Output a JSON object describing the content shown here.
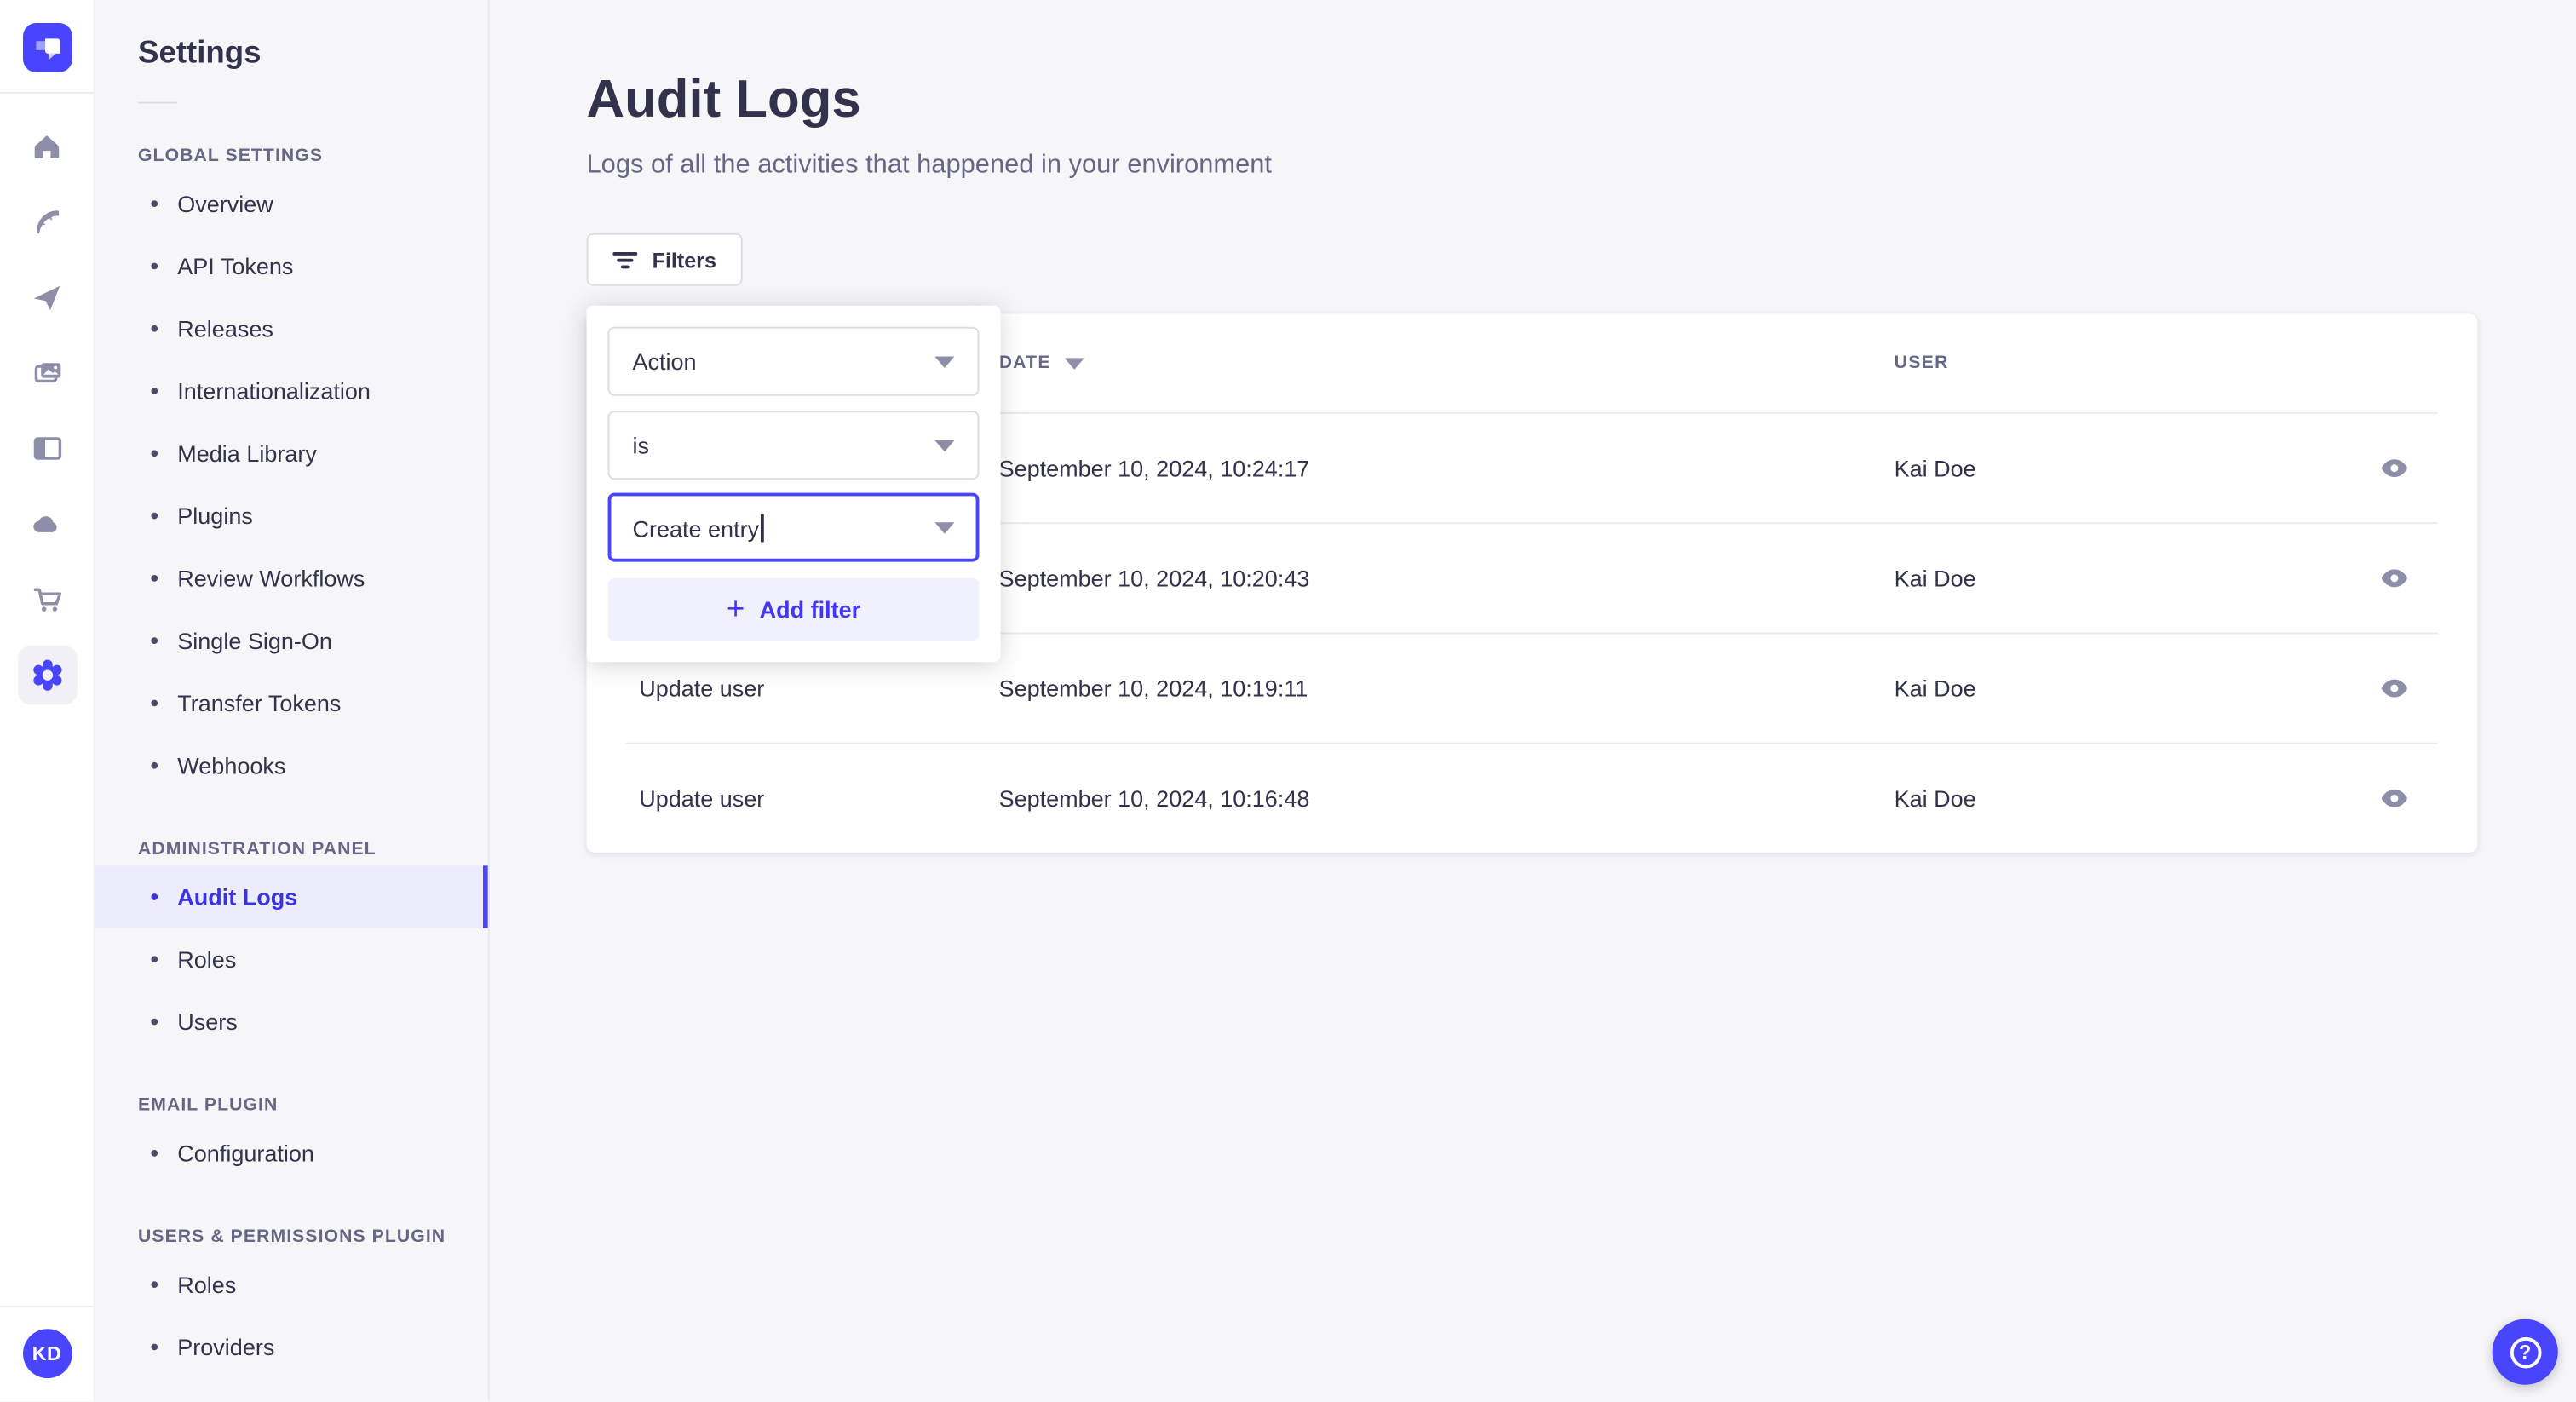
{
  "colors": {
    "accent": "#4945ff",
    "accent_light_bg": "#f0f0ff",
    "active_nav_text": "#3a33e0",
    "text": "#32324d",
    "muted_text": "#666687",
    "icon_gray": "#8e8ea9",
    "border": "#dcdce4",
    "divider": "#eaeaef",
    "page_bg": "#f6f6f9"
  },
  "icon_rail": {
    "logo_icon": "strapi-logo",
    "items": [
      {
        "icon": "home-icon"
      },
      {
        "icon": "feather-icon"
      },
      {
        "icon": "paper-plane-icon"
      },
      {
        "icon": "media-library-icon"
      },
      {
        "icon": "layout-icon"
      },
      {
        "icon": "cloud-icon"
      },
      {
        "icon": "cart-icon"
      },
      {
        "icon": "gear-icon",
        "active": true
      }
    ],
    "avatar_initials": "KD"
  },
  "sidebar": {
    "title": "Settings",
    "sections": [
      {
        "label": "Global Settings",
        "items": [
          {
            "label": "Overview"
          },
          {
            "label": "API Tokens"
          },
          {
            "label": "Releases"
          },
          {
            "label": "Internationalization"
          },
          {
            "label": "Media Library"
          },
          {
            "label": "Plugins"
          },
          {
            "label": "Review Workflows"
          },
          {
            "label": "Single Sign-On"
          },
          {
            "label": "Transfer Tokens"
          },
          {
            "label": "Webhooks"
          }
        ]
      },
      {
        "label": "Administration Panel",
        "items": [
          {
            "label": "Audit Logs",
            "active": true
          },
          {
            "label": "Roles"
          },
          {
            "label": "Users"
          }
        ]
      },
      {
        "label": "Email Plugin",
        "items": [
          {
            "label": "Configuration"
          }
        ]
      },
      {
        "label": "Users & Permissions plugin",
        "items": [
          {
            "label": "Roles"
          },
          {
            "label": "Providers"
          }
        ]
      }
    ]
  },
  "main": {
    "title": "Audit Logs",
    "subtitle": "Logs of all the activities that happened in your environment",
    "filters_button_label": "Filters",
    "filter_popover": {
      "field_select_value": "Action",
      "operator_select_value": "is",
      "value_combobox_value": "Create entry",
      "add_filter_label": "Add filter"
    },
    "table": {
      "headers": {
        "action": "",
        "date": "Date",
        "user": "User"
      },
      "date_sorted": "descending",
      "rows": [
        {
          "action": "",
          "date": "September 10, 2024, 10:24:17",
          "user": "Kai Doe"
        },
        {
          "action": "",
          "date": "September 10, 2024, 10:20:43",
          "user": "Kai Doe"
        },
        {
          "action": "Update user",
          "date": "September 10, 2024, 10:19:11",
          "user": "Kai Doe"
        },
        {
          "action": "Update user",
          "date": "September 10, 2024, 10:16:48",
          "user": "Kai Doe"
        }
      ]
    }
  }
}
